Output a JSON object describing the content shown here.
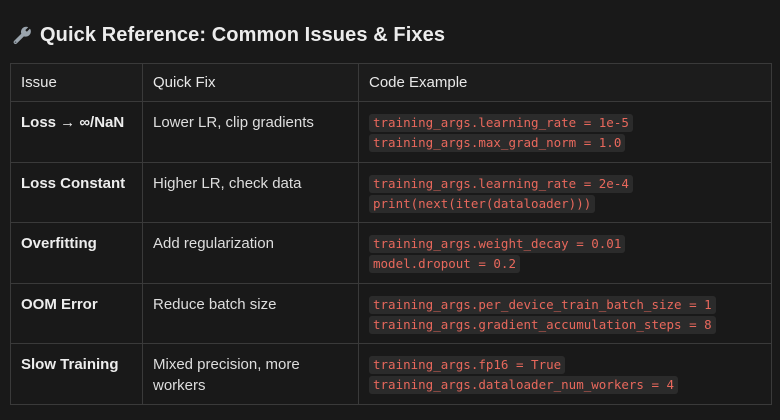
{
  "heading": {
    "icon": "wrench-icon",
    "text": "Quick Reference: Common Issues & Fixes"
  },
  "table": {
    "headers": [
      "Issue",
      "Quick Fix",
      "Code Example"
    ],
    "rows": [
      {
        "issue": "Loss → ∞/NaN",
        "fix": "Lower LR, clip gradients",
        "code": [
          "training_args.learning_rate = 1e-5",
          "training_args.max_grad_norm = 1.0"
        ]
      },
      {
        "issue": "Loss Constant",
        "fix": "Higher LR, check data",
        "code": [
          "training_args.learning_rate = 2e-4",
          "print(next(iter(dataloader)))"
        ]
      },
      {
        "issue": "Overfitting",
        "fix": "Add regularization",
        "code": [
          "training_args.weight_decay = 0.01",
          "model.dropout = 0.2"
        ]
      },
      {
        "issue": "OOM Error",
        "fix": "Reduce batch size",
        "code": [
          "training_args.per_device_train_batch_size = 1",
          "training_args.gradient_accumulation_steps = 8"
        ]
      },
      {
        "issue": "Slow Training",
        "fix": "Mixed precision, more workers",
        "code": [
          "training_args.fp16 = True",
          "training_args.dataloader_num_workers = 4"
        ]
      }
    ]
  },
  "colors": {
    "background": "#191919",
    "border": "#3a3a3a",
    "code_text": "#e8685c",
    "code_background": "#2b2b2b"
  }
}
